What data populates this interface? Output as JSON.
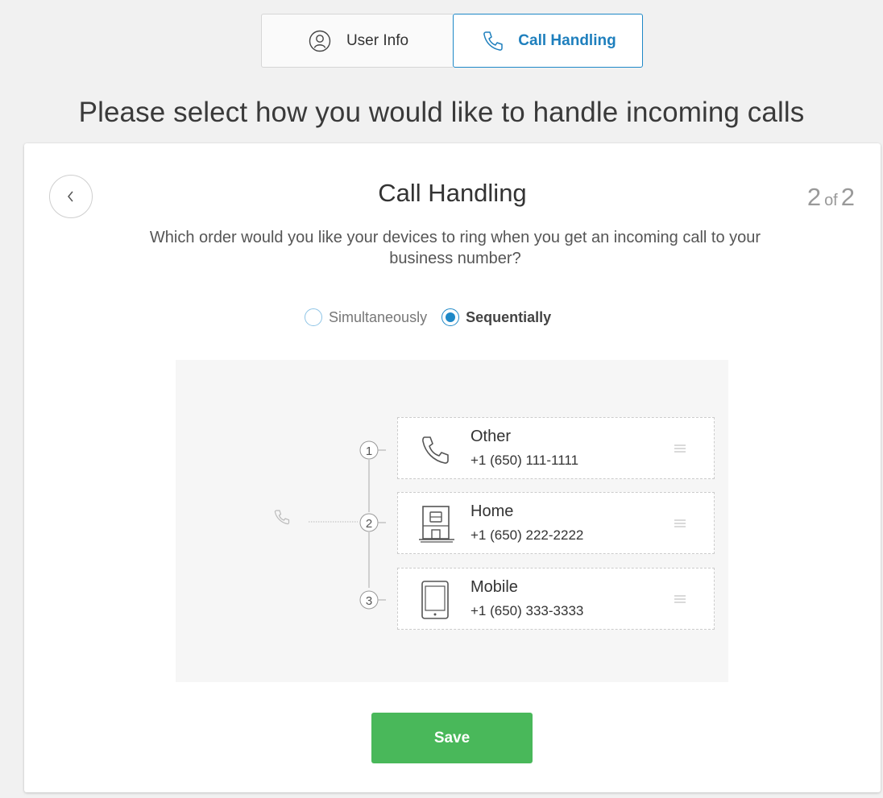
{
  "tabs": [
    {
      "label": "User Info",
      "icon": "user-icon"
    },
    {
      "label": "Call Handling",
      "icon": "phone-icon",
      "active": true
    }
  ],
  "headline": "Please select how you would like to handle incoming calls",
  "card": {
    "title": "Call Handling",
    "step_current": "2",
    "step_of": "of",
    "step_total": "2",
    "question": "Which order would you like your devices to ring when you get an incoming call to your business number?"
  },
  "ring_mode": {
    "options": [
      {
        "label": "Simultaneously",
        "selected": false
      },
      {
        "label": "Sequentially",
        "selected": true
      }
    ]
  },
  "devices": [
    {
      "order": "1",
      "name": "Other",
      "number": "+1 (650) 111-1111",
      "icon": "phone-icon"
    },
    {
      "order": "2",
      "name": "Home",
      "number": "+1 (650) 222-2222",
      "icon": "house-icon"
    },
    {
      "order": "3",
      "name": "Mobile",
      "number": "+1 (650) 333-3333",
      "icon": "mobile-icon"
    }
  ],
  "save_label": "Save",
  "colors": {
    "accent": "#1e88c7",
    "save": "#49b85a",
    "background": "#f1f1f1"
  }
}
